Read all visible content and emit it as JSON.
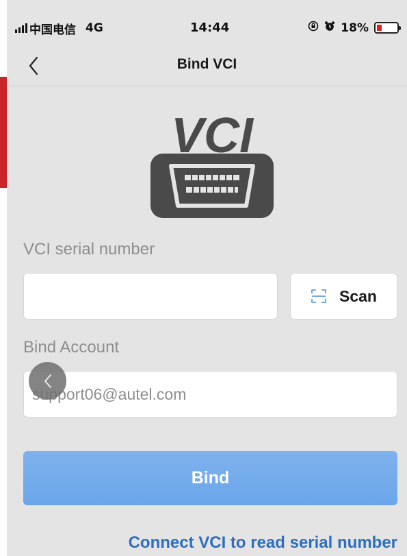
{
  "status_bar": {
    "carrier": "中国电信",
    "network": "4G",
    "time": "14:44",
    "battery": "18%",
    "battery_level": 0.18
  },
  "nav": {
    "title": "Bind VCI"
  },
  "logo": {
    "text": "VCI"
  },
  "form": {
    "serial_label": "VCI serial number",
    "serial_value": "",
    "scan_label": "Scan",
    "account_label": "Bind Account",
    "account_value": "support06@autel.com"
  },
  "actions": {
    "bind_label": "Bind",
    "connect_link": "Connect VCI to read serial number"
  },
  "colors": {
    "background": "#e4e4e4",
    "bind_button": "#6aa6ea",
    "link": "#2e6fbd",
    "scan_icon": "#4a90d9",
    "battery_low": "#e02020"
  }
}
